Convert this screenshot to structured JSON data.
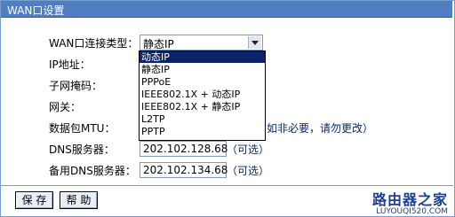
{
  "window": {
    "title": "WAN口设置"
  },
  "form": {
    "conn_type_label": "WAN口连接类型：",
    "conn_type_value": "静态IP",
    "ip_label": "IP地址：",
    "mask_label": "子网掩码：",
    "gateway_label": "网关：",
    "mtu_label": "数据包MTU：",
    "mtu_note": "如非必要，请勿更改）",
    "dns_label": "DNS服务器：",
    "dns_value": "202.102.128.68",
    "dns_opt": "（可选）",
    "dns2_label": "备用DNS服务器：",
    "dns2_value": "202.102.134.68",
    "dns2_opt": "（可选）"
  },
  "dropdown": {
    "options": [
      "动态IP",
      "静态IP",
      "PPPoE",
      "IEEE802.1X + 动态IP",
      "IEEE802.1X + 静态IP",
      "L2TP",
      "PPTP"
    ],
    "highlighted_index": 0
  },
  "footer": {
    "save_label": "保 存",
    "help_label": "帮 助"
  },
  "watermark": {
    "title": "路由器之家",
    "url": "LUYOUQI520.COM"
  }
}
